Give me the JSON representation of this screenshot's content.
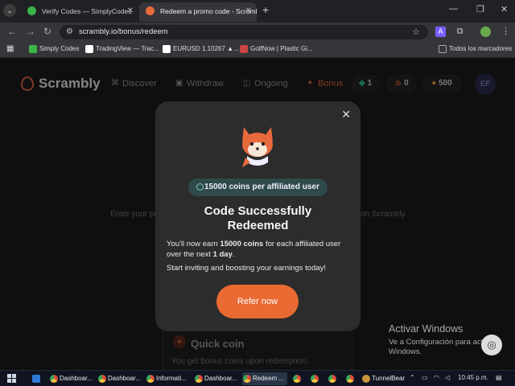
{
  "browser": {
    "tabs": [
      {
        "title": "Verify Codes — SimplyCodes",
        "active": false,
        "favicon_color": "#39b54a"
      },
      {
        "title": "Redeem a promo code - Scrambly",
        "active": true,
        "favicon_color": "#e8693c"
      }
    ],
    "new_tab_label": "+",
    "address": "scrambly.io/bonus/redeem",
    "extension_letter": "A",
    "bookmarks": [
      {
        "label": "Simply Codes",
        "icon_color": "#39b54a"
      },
      {
        "label": "TradingView — Trac...",
        "icon_color": "#ffffff"
      },
      {
        "label": "EURUSD 1.10267 ▲...",
        "icon_color": "#ffffff"
      },
      {
        "label": "GolfNow | Plastic Gi...",
        "icon_color": "#c44"
      },
      {
        "label": "Todos los marcadores",
        "icon_color": "#aaaaaa"
      }
    ]
  },
  "site": {
    "logo": "Scrambly",
    "nav": [
      {
        "label": "Discover",
        "icon": "gamepad-icon"
      },
      {
        "label": "Withdraw",
        "icon": "withdraw-icon"
      },
      {
        "label": "Ongoing",
        "icon": "ongoing-icon"
      },
      {
        "label": "Bonus",
        "icon": "gift-icon"
      }
    ],
    "pills": [
      {
        "value": "1",
        "icon": "gem-icon",
        "color": "#2dbf8f"
      },
      {
        "value": "0",
        "icon": "flame-icon",
        "color": "#e8693c"
      },
      {
        "value": "500",
        "icon": "coin-icon",
        "color": "#f2a33a"
      }
    ],
    "avatar": "EF",
    "background_text_left": "Enter your pr",
    "background_text_right": "on Scrambly.",
    "quick_coin": {
      "title": "Quick coin",
      "description": "You get bonus coins upon redemption."
    }
  },
  "modal": {
    "badge": "15000 coins per affiliated user",
    "title_line1": "Code Successfully",
    "title_line2": "Redeemed",
    "text1_pre": "You'll now earn ",
    "text1_coins": "15000 coins",
    "text1_mid": " for each affiliated user over the next ",
    "text1_days": "1 day",
    "text1_post": ".",
    "text2": "Start inviting and boosting your earnings today!",
    "button": "Refer now"
  },
  "windows_watermark": {
    "title": "Activar Windows",
    "line2": "Ve a Configuración para activar",
    "line3": "Windows."
  },
  "taskbar": {
    "items": [
      {
        "label": "Dashboar...",
        "active": false
      },
      {
        "label": "Dashboar...",
        "active": false
      },
      {
        "label": "Informati...",
        "active": false
      },
      {
        "label": "Dashboar...",
        "active": false
      },
      {
        "label": "Redeem ...",
        "active": true
      }
    ],
    "tunnelbear": "TunnelBear",
    "time": "10:45 p.m."
  }
}
